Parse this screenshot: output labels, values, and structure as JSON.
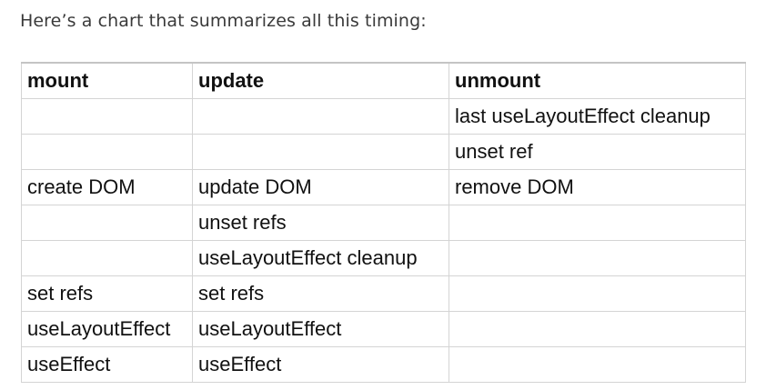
{
  "intro_text": "Here’s a chart that summarizes all this timing:",
  "table": {
    "headers": [
      "mount",
      "update",
      "unmount"
    ],
    "rows": [
      [
        "",
        "",
        "last useLayoutEffect cleanup"
      ],
      [
        "",
        "",
        "unset ref"
      ],
      [
        "create DOM",
        "update DOM",
        "remove DOM"
      ],
      [
        "",
        "unset refs",
        ""
      ],
      [
        "",
        "useLayoutEffect cleanup",
        ""
      ],
      [
        "set refs",
        "set refs",
        ""
      ],
      [
        "useLayoutEffect",
        "useLayoutEffect",
        ""
      ],
      [
        "useEffect",
        "useEffect",
        ""
      ]
    ]
  }
}
